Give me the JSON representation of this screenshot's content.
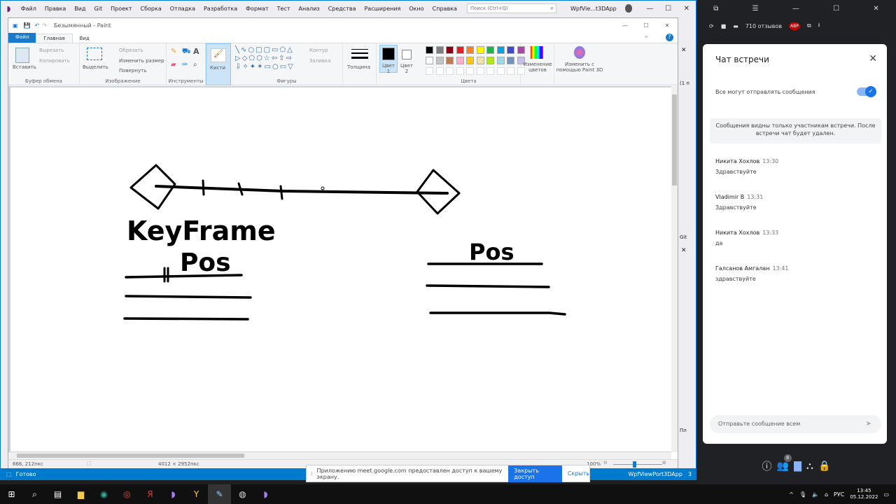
{
  "vs": {
    "menu": [
      "Файл",
      "Правка",
      "Вид",
      "Git",
      "Проект",
      "Сборка",
      "Отладка",
      "Разработка",
      "Формат",
      "Тест",
      "Анализ",
      "Средства",
      "Расширения",
      "Окно",
      "Справка"
    ],
    "search_placeholder": "Поиск (Ctrl+Q)",
    "window_title": "WpfVie...t3DApp",
    "status": {
      "ready": "Готово",
      "project": "WpfViewPort3DApp",
      "errors": "3"
    },
    "right_dock": {
      "tab1": "(1 п",
      "tab2": "Git",
      "tab3": "Пл"
    }
  },
  "paint": {
    "title": "Безымянный - Paint",
    "tabs": {
      "file": "Файл",
      "home": "Главная",
      "view": "Вид"
    },
    "clipboard": {
      "paste": "Вставить",
      "cut": "Вырезать",
      "copy": "Копировать",
      "label": "Буфер обмена"
    },
    "image": {
      "select": "Выделить",
      "crop": "Обрезать",
      "resize": "Изменить размер",
      "rotate": "Повернуть",
      "label": "Изображение"
    },
    "tools_label": "Инструменты",
    "brushes": "Кисти",
    "shapes": {
      "outline": "Контур",
      "fill": "Заливка",
      "label": "Фигуры"
    },
    "thickness": "Толщина",
    "color1": "Цвет 1",
    "color2": "Цвет 2",
    "colors_label": "Цвета",
    "edit_colors": "Изменение цветов",
    "paint3d": "Изменить с помощью Paint 3D",
    "palette_row1": [
      "#000000",
      "#7f7f7f",
      "#880015",
      "#ed1c24",
      "#ff7f27",
      "#fff200",
      "#22b14c",
      "#00a2e8",
      "#3f48cc",
      "#a349a4"
    ],
    "palette_row2": [
      "#ffffff",
      "#c3c3c3",
      "#b97a57",
      "#ffaec9",
      "#ffc90e",
      "#efe4b0",
      "#b5e61d",
      "#99d9ea",
      "#7092be",
      "#c8bfe7"
    ],
    "status": {
      "pos": "666, 212пкс",
      "size": "4012 × 2952пкс",
      "zoom": "100%"
    },
    "drawing": {
      "keyframe": "KeyFrame",
      "pos_left": "Pos",
      "pos_right": "Pos"
    }
  },
  "share": {
    "text": "Приложению meet.google.com предоставлен доступ к вашему экрану.",
    "stop": "Закрыть доступ",
    "hide": "Скрыть"
  },
  "meet": {
    "ext": {
      "count": "710 отзывов",
      "abp": "ABP"
    },
    "chat": {
      "title": "Чат встречи",
      "toggle_label": "Все могут отправлять сообщения",
      "notice": "Сообщения видны только участникам встречи. После встречи чат будет удален.",
      "messages": [
        {
          "who": "Никита Хохлов",
          "time": "13:30",
          "text": "Здравствуйте"
        },
        {
          "who": "Vladimir B",
          "time": "13:31",
          "text": "Здравствуйте"
        },
        {
          "who": "Никита Хохлов",
          "time": "13:33",
          "text": "да"
        },
        {
          "who": "Галсанов Амгалан",
          "time": "13:41",
          "text": "здравствуйте"
        }
      ],
      "input_placeholder": "Отправьте сообщение всем"
    },
    "participants_badge": "8"
  },
  "taskbar": {
    "lang": "РУС",
    "time": "13:45",
    "date": "05.12.2022"
  }
}
